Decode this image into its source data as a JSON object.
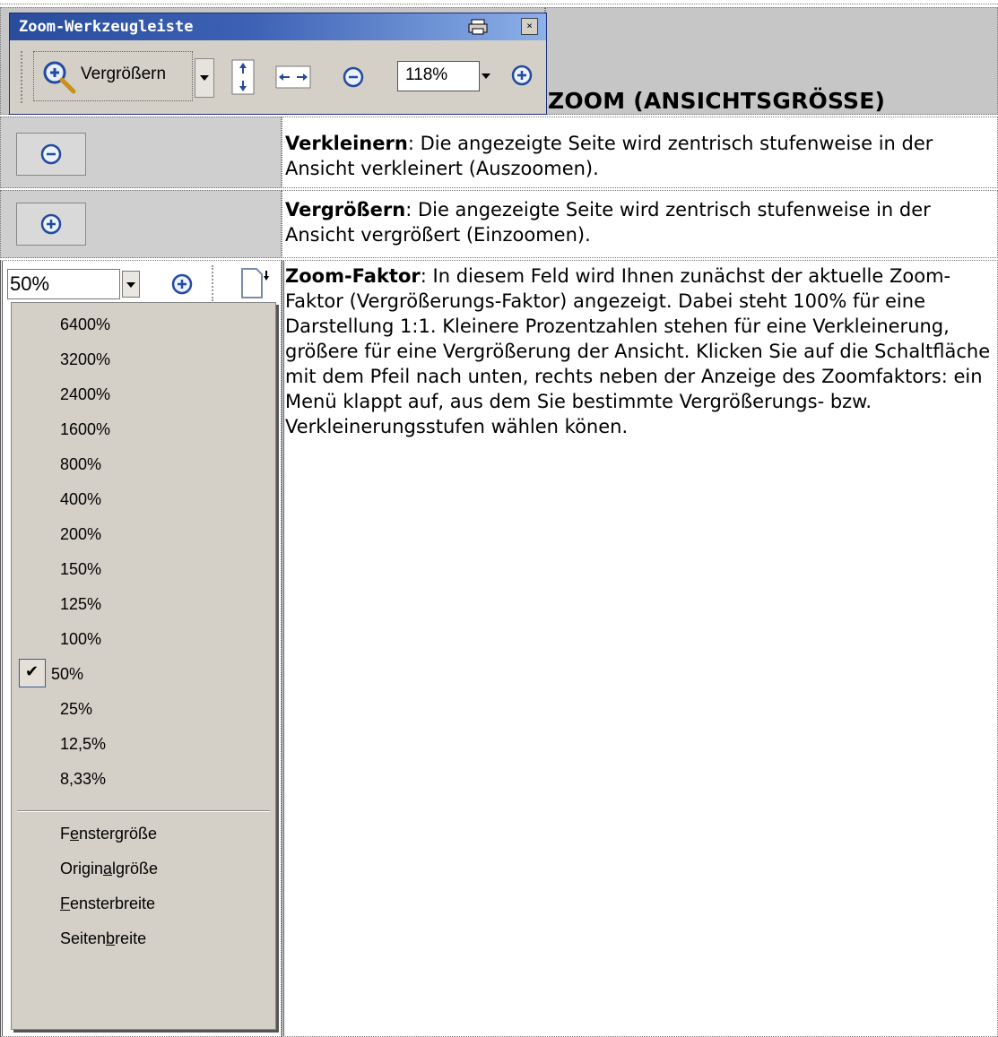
{
  "header": {
    "title": "ZOOM (ANSICHTSGRÖSSE)"
  },
  "toolbar": {
    "window_title": "Zoom-Werkzeugleiste",
    "zoom_button_label": "Vergrößern",
    "zoom_value": "118%",
    "close_glyph": "×",
    "icons": [
      "zoom-in-magnifier-icon",
      "fit-height-icon",
      "fit-width-icon",
      "zoom-out-icon",
      "zoom-in-icon",
      "printer-icon",
      "close-icon"
    ]
  },
  "rows": [
    {
      "icon": "zoom-out-icon",
      "term": "Verkleinern",
      "text": ": Die angezeigte Seite wird zentrisch stufenweise in der Ansicht verkleinert (Auszoomen)."
    },
    {
      "icon": "zoom-in-icon",
      "term": "Vergrößern",
      "text": ": Die angezeigte Seite wird zentrisch stufenweise in der Ansicht vergrößert (Einzoomen)."
    },
    {
      "term": "Zoom-Faktor",
      "text": ": In diesem Feld wird Ihnen zunächst der aktuelle Zoom-Faktor (Vergrößerungs-Faktor) angezeigt. Dabei steht 100% für eine Darstellung 1:1. Kleinere Prozentzahlen stehen für eine Verkleinerung, größere für eine Vergrößerung der Ansicht. Klicken Sie auf die Schaltfläche mit dem Pfeil nach unten, rechts neben der Anzeige des Zoomfaktors: ein Menü klappt auf, aus dem Sie bestimmte Vergrößerungs- bzw. Verkleinerungsstufen wählen könen."
    }
  ],
  "zoom_menu": {
    "current_value": "50%",
    "items": [
      "6400%",
      "3200%",
      "2400%",
      "1600%",
      "800%",
      "400%",
      "200%",
      "150%",
      "125%",
      "100%",
      "50%",
      "25%",
      "12,5%",
      "8,33%"
    ],
    "selected": "50%",
    "fit_items": [
      {
        "pre": "F",
        "ul": "e",
        "post": "nstergröße"
      },
      {
        "pre": "Origin",
        "ul": "a",
        "post": "lgröße"
      },
      {
        "pre": "",
        "ul": "F",
        "post": "ensterbreite"
      },
      {
        "pre": "Seiten",
        "ul": "b",
        "post": "reite"
      }
    ]
  }
}
